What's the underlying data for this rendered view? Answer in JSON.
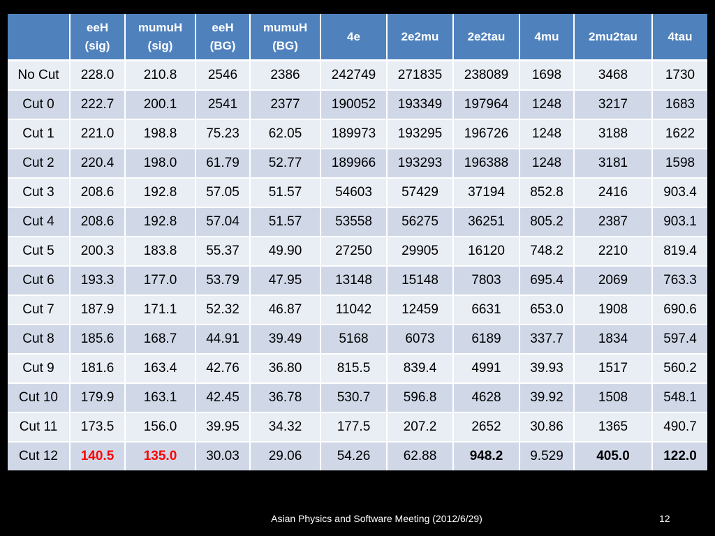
{
  "table": {
    "columns": [
      {
        "line1": "",
        "line2": ""
      },
      {
        "line1": "eeH",
        "line2": "(sig)"
      },
      {
        "line1": "mumuH",
        "line2": "(sig)"
      },
      {
        "line1": "eeH",
        "line2": "(BG)"
      },
      {
        "line1": "mumuH",
        "line2": "(BG)"
      },
      {
        "line1": "4e",
        "line2": ""
      },
      {
        "line1": "2e2mu",
        "line2": ""
      },
      {
        "line1": "2e2tau",
        "line2": ""
      },
      {
        "line1": "4mu",
        "line2": ""
      },
      {
        "line1": "2mu2tau",
        "line2": ""
      },
      {
        "line1": "4tau",
        "line2": ""
      }
    ],
    "rows": [
      [
        "No Cut",
        "228.0",
        "210.8",
        "2546",
        "2386",
        "242749",
        "271835",
        "238089",
        "1698",
        "3468",
        "1730"
      ],
      [
        "Cut 0",
        "222.7",
        "200.1",
        "2541",
        "2377",
        "190052",
        "193349",
        "197964",
        "1248",
        "3217",
        "1683"
      ],
      [
        "Cut 1",
        "221.0",
        "198.8",
        "75.23",
        "62.05",
        "189973",
        "193295",
        "196726",
        "1248",
        "3188",
        "1622"
      ],
      [
        "Cut 2",
        "220.4",
        "198.0",
        "61.79",
        "52.77",
        "189966",
        "193293",
        "196388",
        "1248",
        "3181",
        "1598"
      ],
      [
        "Cut 3",
        "208.6",
        "192.8",
        "57.05",
        "51.57",
        "54603",
        "57429",
        "37194",
        "852.8",
        "2416",
        "903.4"
      ],
      [
        "Cut 4",
        "208.6",
        "192.8",
        "57.04",
        "51.57",
        "53558",
        "56275",
        "36251",
        "805.2",
        "2387",
        "903.1"
      ],
      [
        "Cut 5",
        "200.3",
        "183.8",
        "55.37",
        "49.90",
        "27250",
        "29905",
        "16120",
        "748.2",
        "2210",
        "819.4"
      ],
      [
        "Cut 6",
        "193.3",
        "177.0",
        "53.79",
        "47.95",
        "13148",
        "15148",
        "7803",
        "695.4",
        "2069",
        "763.3"
      ],
      [
        "Cut 7",
        "187.9",
        "171.1",
        "52.32",
        "46.87",
        "11042",
        "12459",
        "6631",
        "653.0",
        "1908",
        "690.6"
      ],
      [
        "Cut 8",
        "185.6",
        "168.7",
        "44.91",
        "39.49",
        "5168",
        "6073",
        "6189",
        "337.7",
        "1834",
        "597.4"
      ],
      [
        "Cut 9",
        "181.6",
        "163.4",
        "42.76",
        "36.80",
        "815.5",
        "839.4",
        "4991",
        "39.93",
        "1517",
        "560.2"
      ],
      [
        "Cut 10",
        "179.9",
        "163.1",
        "42.45",
        "36.78",
        "530.7",
        "596.8",
        "4628",
        "39.92",
        "1508",
        "548.1"
      ],
      [
        "Cut 11",
        "173.5",
        "156.0",
        "39.95",
        "34.32",
        "177.5",
        "207.2",
        "2652",
        "30.86",
        "1365",
        "490.7"
      ],
      [
        "Cut 12",
        "140.5",
        "135.0",
        "30.03",
        "29.06",
        "54.26",
        "62.88",
        "948.2",
        "9.529",
        "405.0",
        "122.0"
      ]
    ],
    "highlight_color": "#ff0000",
    "header_color": "#4f81bd",
    "row_colors": [
      "#e9edf4",
      "#d0d8e8"
    ]
  },
  "footer": {
    "text": "Asian Physics and Software Meeting (2012/6/29)",
    "page_number": "12"
  }
}
